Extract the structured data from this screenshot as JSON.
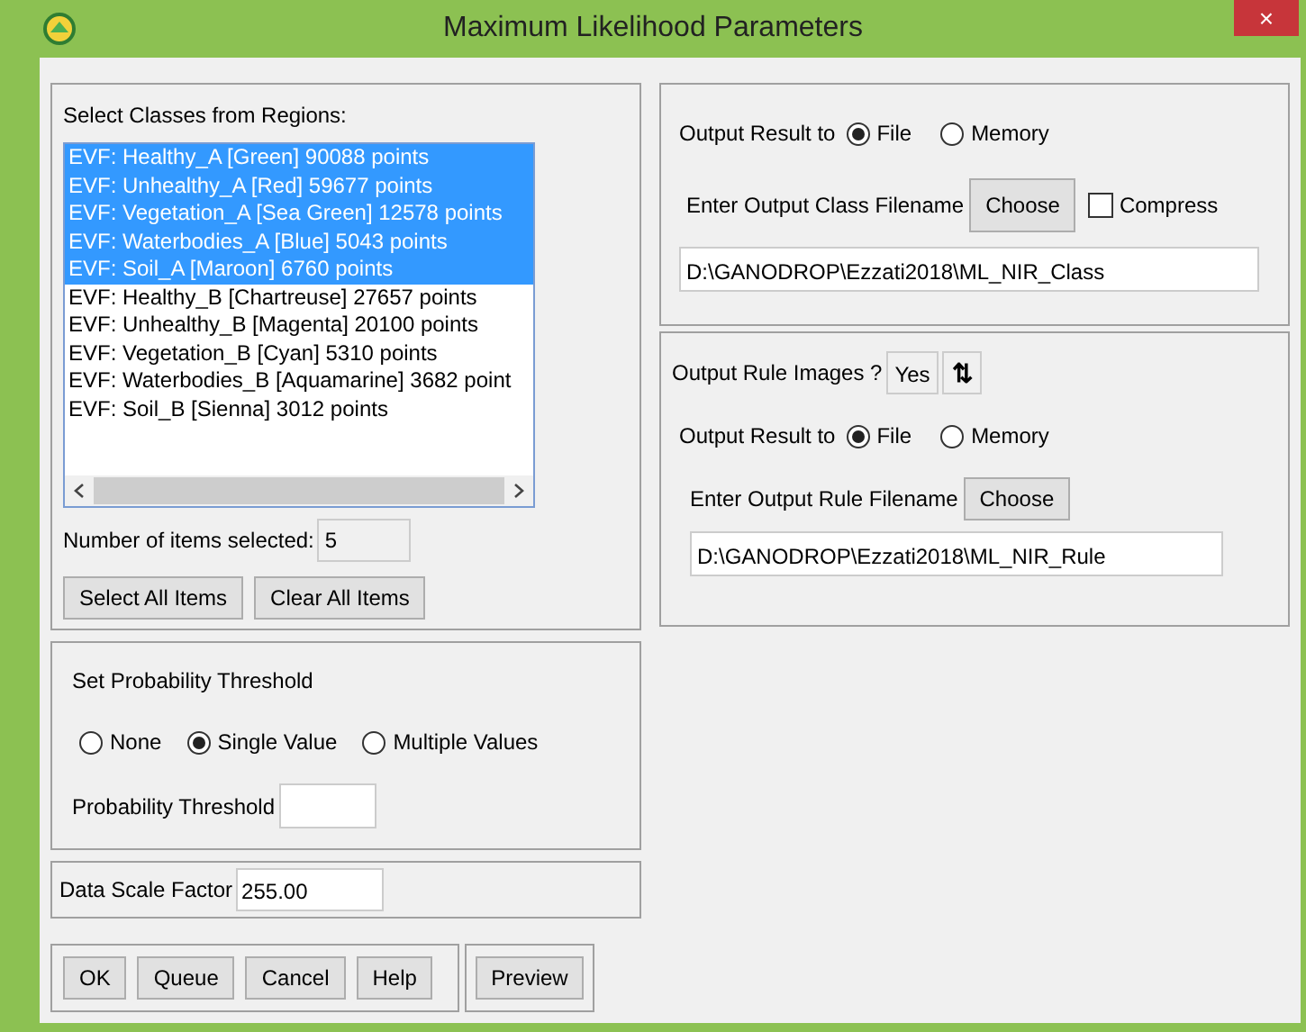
{
  "window": {
    "title": "Maximum Likelihood Parameters",
    "close": "×"
  },
  "classes": {
    "label": "Select Classes from Regions:",
    "items": [
      {
        "label": "EVF: Healthy_A [Green] 90088 points",
        "selected": true
      },
      {
        "label": "EVF: Unhealthy_A [Red] 59677 points",
        "selected": true
      },
      {
        "label": "EVF: Vegetation_A [Sea Green] 12578 points",
        "selected": true
      },
      {
        "label": "EVF: Waterbodies_A [Blue] 5043 points",
        "selected": true
      },
      {
        "label": "EVF: Soil_A [Maroon] 6760 points",
        "selected": true
      },
      {
        "label": "EVF: Healthy_B [Chartreuse] 27657 points",
        "selected": false
      },
      {
        "label": "EVF: Unhealthy_B [Magenta] 20100 points",
        "selected": false
      },
      {
        "label": "EVF: Vegetation_B [Cyan] 5310 points",
        "selected": false
      },
      {
        "label": "EVF: Waterbodies_B [Aquamarine] 3682 point",
        "selected": false
      },
      {
        "label": "EVF: Soil_B [Sienna] 3012 points",
        "selected": false
      }
    ],
    "count_label": "Number of items selected:",
    "count": "5",
    "buttons": [
      "Select All Items",
      "Clear All Items"
    ]
  },
  "threshold": {
    "title": "Set Probability Threshold",
    "options": [
      {
        "label": "None",
        "selected": false
      },
      {
        "label": "Single Value",
        "selected": true
      },
      {
        "label": "Multiple Values",
        "selected": false
      }
    ],
    "field_label": "Probability Threshold"
  },
  "scale": {
    "label": "Data Scale Factor",
    "value": "255.00"
  },
  "buttons": [
    "OK",
    "Queue",
    "Cancel",
    "Help"
  ],
  "preview": "Preview",
  "output_class": {
    "label": "Output Result to",
    "options": [
      {
        "label": "File",
        "selected": true
      },
      {
        "label": "Memory",
        "selected": false
      }
    ],
    "filename_label": "Enter Output Class Filename",
    "choose": "Choose",
    "compress": {
      "label": "Compress",
      "checked": false
    },
    "path": "D:\\GANODROP\\Ezzati2018\\ML_NIR_Class"
  },
  "output_rule": {
    "images_label": "Output Rule Images ?",
    "images_value": "Yes",
    "toggle": "⇅",
    "label": "Output Result to",
    "options": [
      {
        "label": "File",
        "selected": true
      },
      {
        "label": "Memory",
        "selected": false
      }
    ],
    "filename_label": "Enter Output Rule Filename",
    "choose": "Choose",
    "path": "D:\\GANODROP\\Ezzati2018\\ML_NIR_Rule"
  }
}
